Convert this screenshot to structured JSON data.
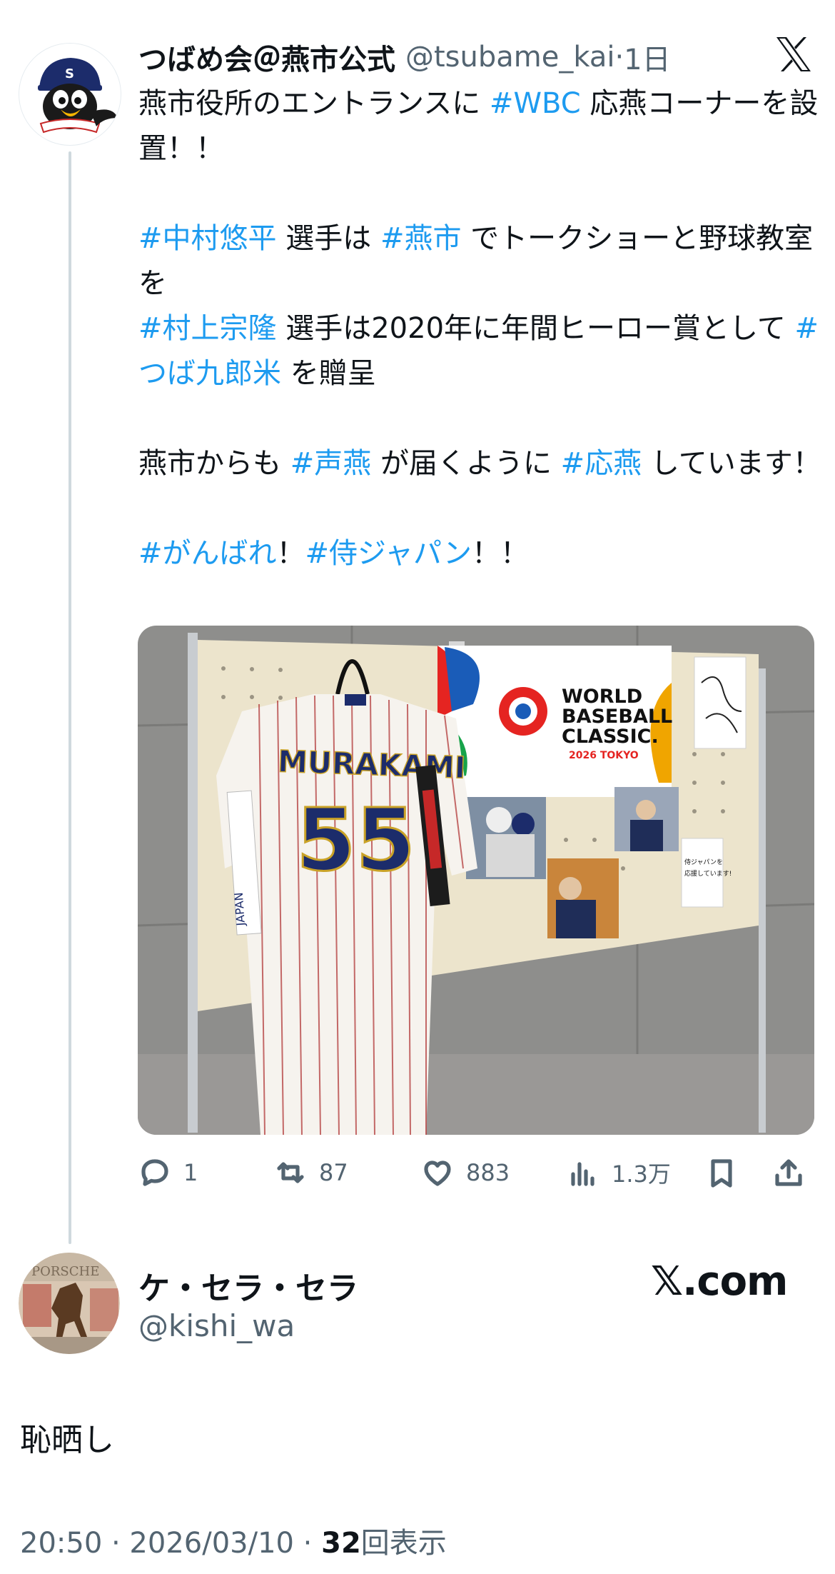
{
  "tweet": {
    "display_name": "つばめ会＠燕市公式",
    "handle": "@tsubame_kai",
    "separator": "·",
    "time": "1日",
    "text_segments": [
      {
        "t": "燕市役所のエントランスに "
      },
      {
        "t": "#WBC",
        "tag": true
      },
      {
        "t": " 応燕コーナーを設置！！\n\n"
      },
      {
        "t": "#中村悠平",
        "tag": true
      },
      {
        "t": " 選手は "
      },
      {
        "t": "#燕市",
        "tag": true
      },
      {
        "t": " でトークショーと野球教室を\n"
      },
      {
        "t": "#村上宗隆",
        "tag": true
      },
      {
        "t": " 選手は2020年に年間ヒーロー賞として "
      },
      {
        "t": "#つば九郎米",
        "tag": true
      },
      {
        "t": " を贈呈\n\n燕市からも "
      },
      {
        "t": "#声燕",
        "tag": true
      },
      {
        "t": " が届くように "
      },
      {
        "t": "#応燕",
        "tag": true
      },
      {
        "t": " しています！\n\n"
      },
      {
        "t": "#がんばれ",
        "tag": true
      },
      {
        "t": "！"
      },
      {
        "t": "#侍ジャパン",
        "tag": true
      },
      {
        "t": "！！"
      }
    ],
    "photo": {
      "banner_line1": "WORLD",
      "banner_line2": "BASEBALL",
      "banner_line3": "CLASSIC.",
      "banner_sub": "2026 TOKYO",
      "jersey_name": "MURAKAMI",
      "jersey_number": "55",
      "sash_text": "JAPAN",
      "card_text_1": "侍ジャパンを",
      "card_text_2": "応援しています!"
    },
    "actions": {
      "replies": "1",
      "retweets": "87",
      "likes": "883",
      "views": "1.3万"
    }
  },
  "reply": {
    "display_name": "ケ・セラ・セラ",
    "handle": "@kishi_wa",
    "brand": "𝕏.com",
    "text": "恥晒し",
    "timestamp": "20:50 · 2026/03/10 · ",
    "views_count": "32",
    "views_label": "回表示"
  },
  "colors": {
    "hashtag": "#1d9bf0",
    "secondary_text": "#536471",
    "primary_text": "#0f1419",
    "thread_line": "#cfd9de"
  }
}
